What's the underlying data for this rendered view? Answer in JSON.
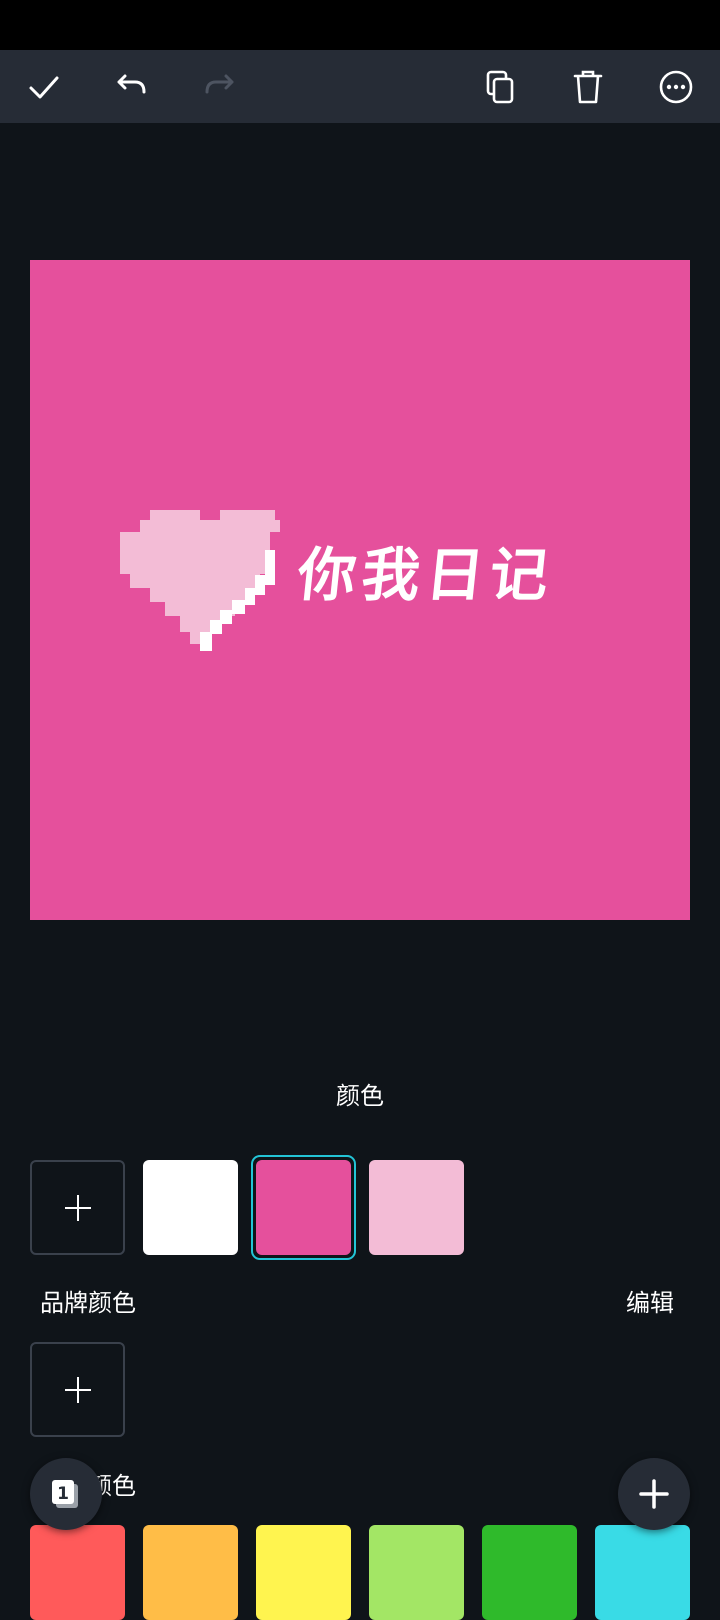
{
  "toolbar": {
    "icons": [
      "check-icon",
      "undo-icon",
      "redo-icon",
      "copy-icon",
      "trash-icon",
      "more-icon"
    ]
  },
  "canvas": {
    "background": "#e5509c",
    "logo_text": "你我日记",
    "heart_color": "#f3bcd6"
  },
  "panel": {
    "title": "颜色",
    "document_colors": [
      "#ffffff",
      "#e5509c",
      "#f3bcd6"
    ],
    "selected_color": "#e5509c",
    "brand_label": "品牌颜色",
    "edit_label": "编辑",
    "default_label": "颜色",
    "default_colors": [
      "#ff5a5a",
      "#ffbd47",
      "#fff44f",
      "#a3e665",
      "#2fba2b",
      "#39dbe6"
    ]
  },
  "page_counter": "1",
  "colors": {
    "accent": "#23c4d6",
    "toolbar_bg": "#262c36",
    "panel_bg": "#0f1419"
  }
}
